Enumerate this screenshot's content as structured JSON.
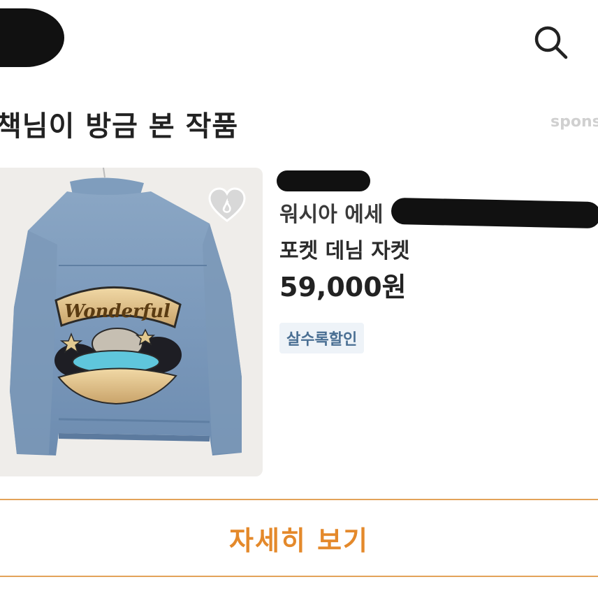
{
  "header": {
    "search_icon": "search-icon"
  },
  "section": {
    "title": "책님이 방금 본 작품",
    "sponsor_label": "spons"
  },
  "product": {
    "image_text": "Wonderful",
    "wishlist_icon": "heart-icon",
    "title_line1": "워시아 에세",
    "title_line2": "포켓 데님 자켓",
    "price": "59,000원",
    "badge": "살수록할인"
  },
  "cta": {
    "detail_label": "자세히 보기"
  },
  "colors": {
    "accent": "#e4892b",
    "accent_border": "#e3a35a",
    "badge_bg": "#eef3f8",
    "badge_text": "#4a6f93"
  }
}
